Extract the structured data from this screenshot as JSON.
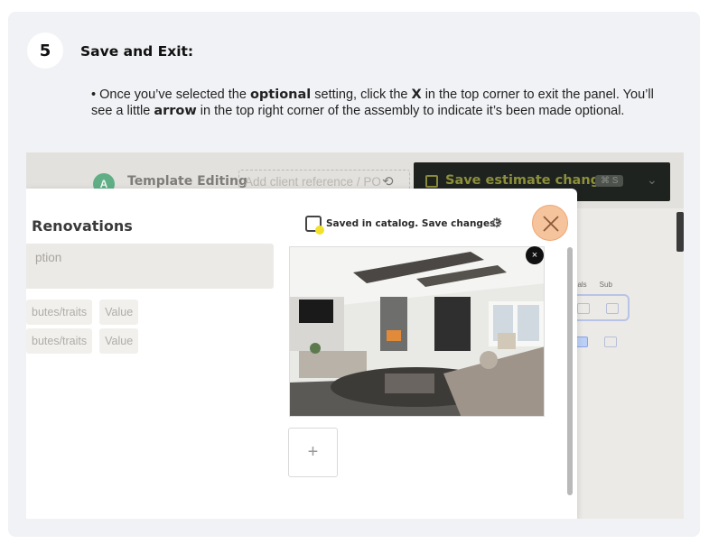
{
  "step": {
    "number": "5",
    "title": "Save and Exit:",
    "instruction": {
      "t1": "• Once you’ve selected the ",
      "b1": "optional",
      "t2": " setting, click the ",
      "b2": "X",
      "t3": " in the top corner to exit the panel. You’ll see a little ",
      "b3": "arrow",
      "t4": " in the top right corner of the assembly to indicate it’s been made optional."
    }
  },
  "screenshot": {
    "header": {
      "avatar_letter": "A",
      "template_label": "Template Editing",
      "client_reference_placeholder": "Add client reference / PO",
      "save_button_label": "Save estimate changes",
      "save_shortcut": "⌘ S"
    },
    "table_columns": [
      "rials",
      "Sub"
    ],
    "panel": {
      "title": "Renovations",
      "saved_status": "Saved in catalog. Save changes?",
      "description_placeholder": "ption",
      "attribute_rows": [
        {
          "name": "butes/traits",
          "value": "Value"
        },
        {
          "name": "butes/traits",
          "value": "Value"
        }
      ],
      "add_photo_symbol": "+",
      "remove_photo_symbol": "×"
    },
    "colors": {
      "close_highlight": "#f6c49c",
      "save_button_bg": "#1e2320",
      "avatar": "#5fae86"
    },
    "icons": [
      "history-icon",
      "save-icon",
      "chevron-down-icon",
      "gear-icon",
      "close-icon",
      "truck-icon"
    ]
  }
}
